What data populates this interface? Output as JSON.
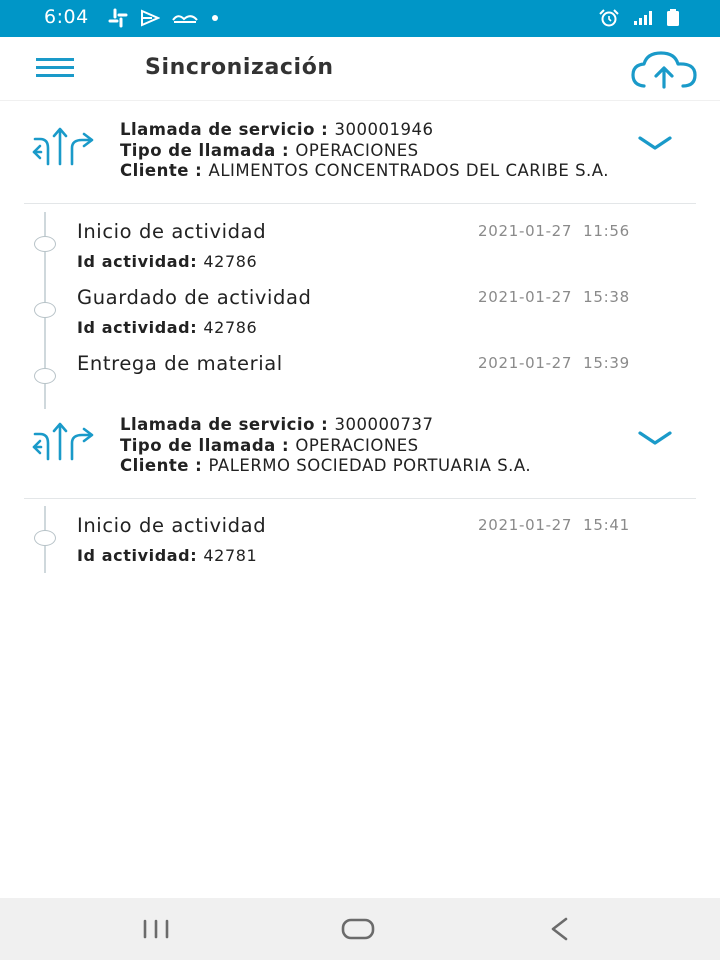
{
  "status_bar": {
    "time": "6:04",
    "left_icons": [
      "slack-icon",
      "play-icon",
      "glasses-icon",
      "dot-icon"
    ],
    "right_icons": [
      "alarm-icon",
      "signal-icon",
      "battery-icon"
    ],
    "color": "#0096c7"
  },
  "app_bar": {
    "title": "Sincronización",
    "menu_icon": "hamburger-menu-icon",
    "upload_icon": "cloud-upload-icon",
    "accent": "#1a9ac9"
  },
  "cards": [
    {
      "llamada_label": "Llamada de servicio : ",
      "llamada_value": "300001946",
      "tipo_label": "Tipo de llamada : ",
      "tipo_value": "OPERACIONES",
      "cliente_label": "Cliente : ",
      "cliente_value": "ALIMENTOS CONCENTRADOS DEL CARIBE S.A.",
      "activities": [
        {
          "title": "Inicio de actividad",
          "date": "2021-01-27  11:56",
          "id_label": "Id actividad: ",
          "id_value": "42786"
        },
        {
          "title": "Guardado de actividad",
          "date": "2021-01-27  15:38",
          "id_label": "Id actividad: ",
          "id_value": "42786"
        },
        {
          "title": "Entrega de material",
          "date": "2021-01-27  15:39"
        }
      ]
    },
    {
      "llamada_label": "Llamada de servicio : ",
      "llamada_value": "300000737",
      "tipo_label": "Tipo de llamada : ",
      "tipo_value": "OPERACIONES",
      "cliente_label": "Cliente : ",
      "cliente_value": "PALERMO SOCIEDAD PORTUARIA S.A.",
      "activities": [
        {
          "title": "Inicio de actividad",
          "date": "2021-01-27  15:41",
          "id_label": "Id actividad: ",
          "id_value": "42781"
        }
      ]
    }
  ],
  "nav_bar": {
    "icons": [
      "recent-apps-icon",
      "home-icon",
      "back-icon"
    ]
  }
}
